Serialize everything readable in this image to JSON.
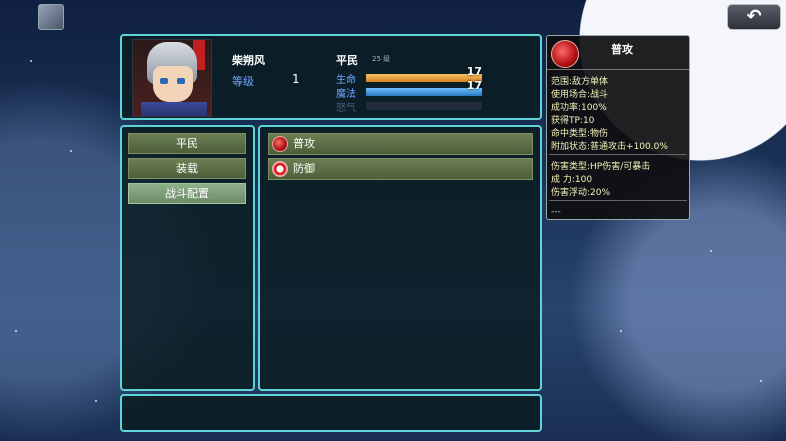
{
  "top": {
    "back_icon": "↶"
  },
  "status": {
    "name": "柴朔风",
    "level_label": "等级",
    "level_value": "1",
    "class_name": "平民",
    "class_sub": "25 级",
    "hp": {
      "label": "生命",
      "value": "17",
      "ratio": 1.0,
      "color": "#f0a040"
    },
    "mp": {
      "label": "魔法",
      "value": "17",
      "ratio": 1.0,
      "color": "#40a0e8"
    },
    "tp": {
      "label": "怒气",
      "value": "",
      "ratio": 0.0
    }
  },
  "commands": [
    {
      "label": "平民"
    },
    {
      "label": "装载"
    },
    {
      "label": "战斗配置"
    }
  ],
  "skills": [
    {
      "label": "普攻",
      "icon": "attack-icon"
    },
    {
      "label": "防御",
      "icon": "defend-icon"
    }
  ],
  "detail": {
    "title": "普攻",
    "lines1": [
      "范围:敌方单体",
      "使用场合:战斗",
      "成功率:100%",
      "获得TP:10",
      "命中类型:物伤",
      "附加状态:普通攻击+100.0%"
    ],
    "lines2": [
      "伤害类型:HP伤害/可暴击",
      "成    力:100",
      "伤害浮动:20%"
    ],
    "footer": "---"
  }
}
